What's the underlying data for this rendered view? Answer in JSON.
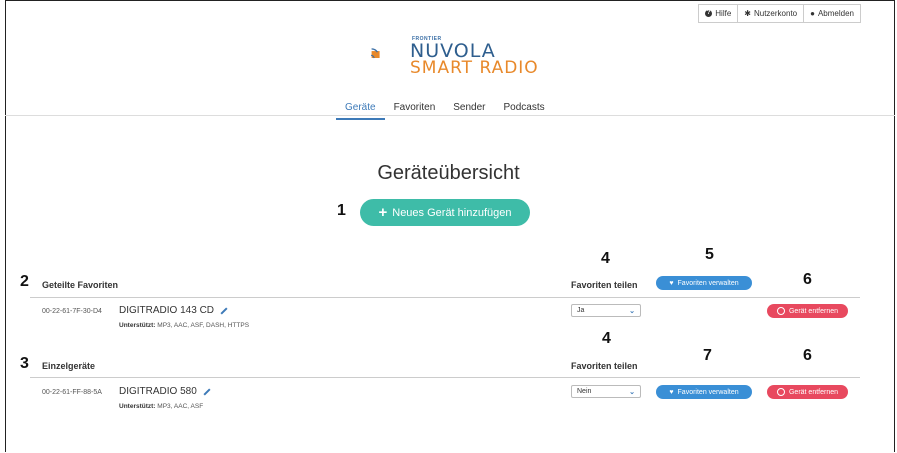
{
  "topbar": {
    "help": "Hilfe",
    "account": "Nutzerkonto",
    "logout": "Abmelden"
  },
  "logo": {
    "frontier": "FRONTIER",
    "line1": "NUVOLA",
    "line2": "SMART RADIO"
  },
  "nav": {
    "items": [
      {
        "label": "Geräte"
      },
      {
        "label": "Favoriten"
      },
      {
        "label": "Sender"
      },
      {
        "label": "Podcasts"
      }
    ]
  },
  "page": {
    "title": "Geräteübersicht",
    "add_device": "Neues Gerät hinzufügen"
  },
  "callouts": {
    "c1": "1",
    "c2": "2",
    "c3": "3",
    "c4a": "4",
    "c4b": "4",
    "c5": "5",
    "c6a": "6",
    "c6b": "6",
    "c7": "7"
  },
  "sections": [
    {
      "title": "Geteilte Favoriten",
      "column": "Favoriten teilen",
      "device": {
        "mac": "00-22-61-7F-30-D4",
        "name": "DIGITRADIO 143 CD",
        "supported_label": "Unterstützt:",
        "supported": "MP3, AAC, ASF, DASH, HTTPS",
        "share": "Ja",
        "manage": "Favoriten verwalten",
        "remove": "Gerät entfernen"
      }
    },
    {
      "title": "Einzelgeräte",
      "column": "Favoriten teilen",
      "device": {
        "mac": "00-22-61-FF-88-5A",
        "name": "DIGITRADIO 580",
        "supported_label": "Unterstützt:",
        "supported": "MP3, AAC, ASF",
        "share": "Nein",
        "manage": "Favoriten verwalten",
        "remove": "Gerät entfernen"
      }
    }
  ],
  "colors": {
    "accent": "#3d7ab8",
    "add_button": "#3ebca8",
    "manage_button": "#3a8fd6",
    "remove_button": "#e8495f"
  }
}
